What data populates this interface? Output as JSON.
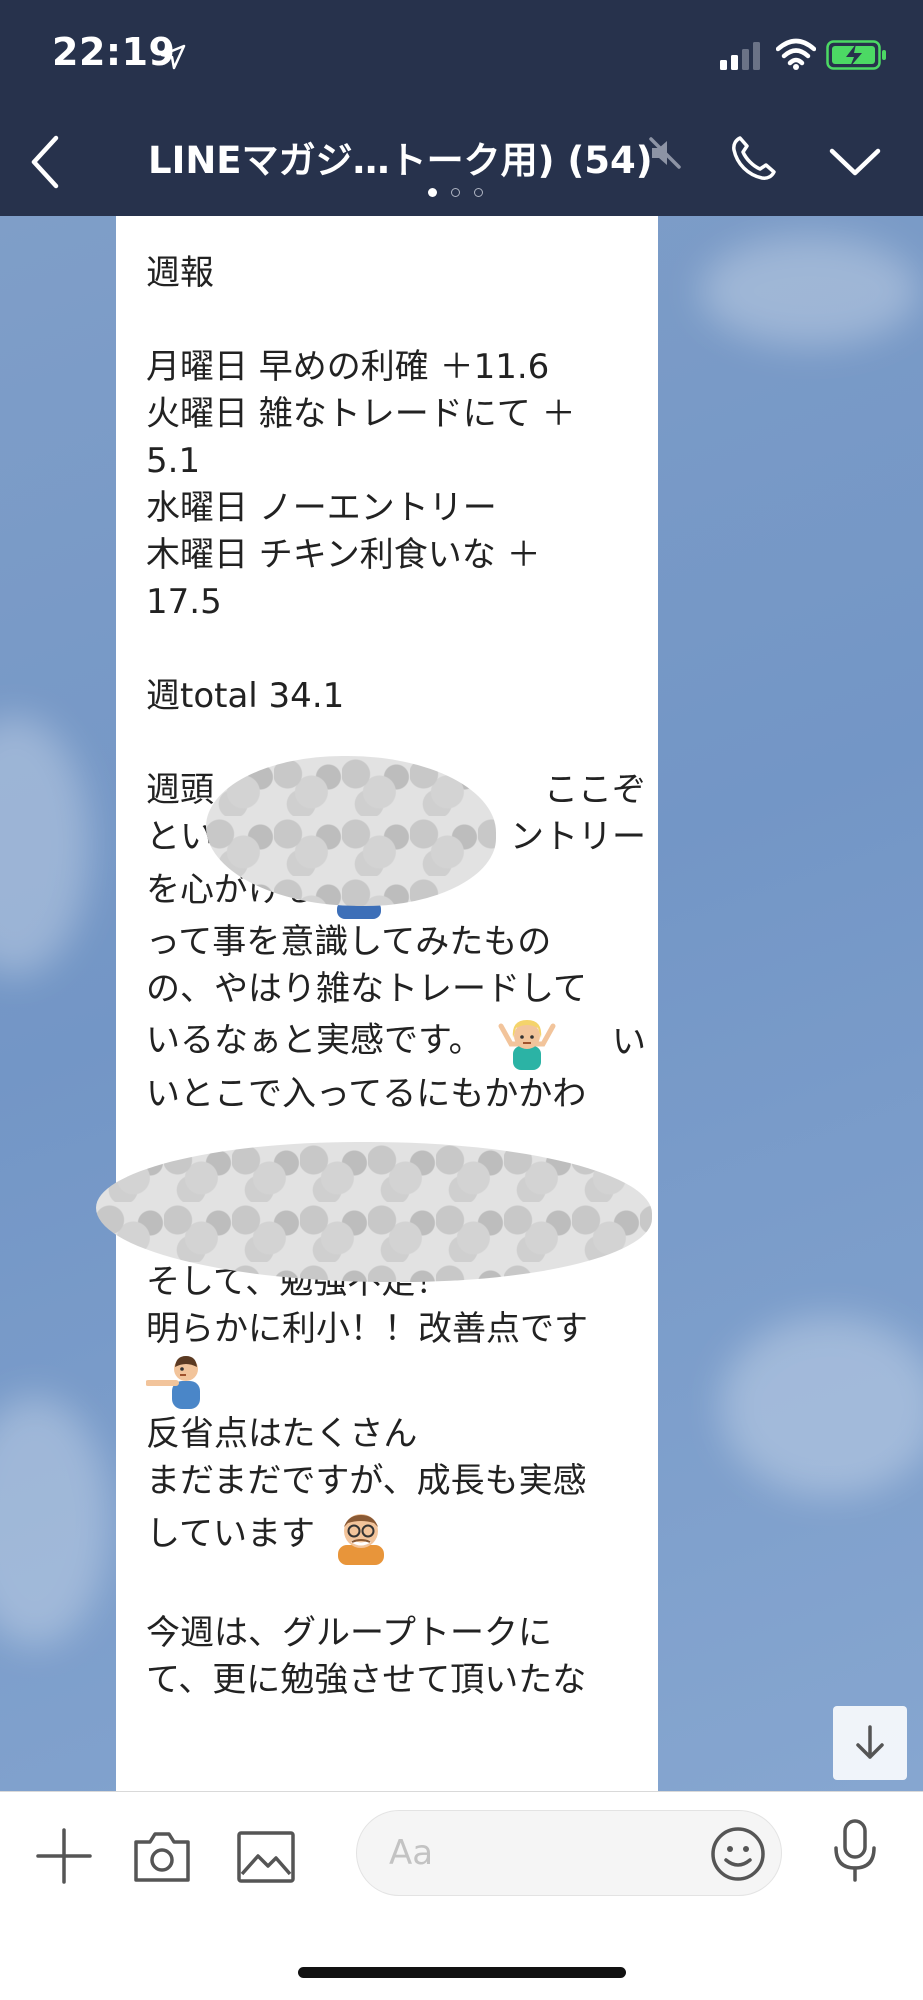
{
  "status_bar": {
    "time": "22:19",
    "icons": [
      "location-arrow-icon",
      "signal-bars-icon",
      "wifi-icon",
      "battery-charging-icon"
    ]
  },
  "header": {
    "title": "LINEマガジ…トーク用) (54)",
    "icons": [
      "back-chevron-icon",
      "mute-icon",
      "phone-icon",
      "chevron-down-icon"
    ],
    "page_dots": 3,
    "active_dot": 0
  },
  "message": {
    "lines": [
      "週報",
      "",
      "月曜日 早めの利確 ＋11.6",
      "火曜日 雑なトレードにて ＋",
      "5.1",
      "水曜日 ノーエントリー",
      "木曜日 チキン利食いな ＋",
      "17.5",
      "",
      "週total 34.1",
      "",
      "週頭",
      "とい",
      "を心がける",
      "って事を意識してみたもの",
      "の、やはり雑なトレードして",
      "いるなぁと実感です。",
      "いとこで入ってるにもかかわ",
      "",
      "",
      "",
      "そして、勉強不足！",
      "明らかに利小！！改善点です",
      "",
      "反省点はたくさん",
      "まだまだですが、成長も実感",
      "しています",
      "",
      "今週は、グループトークに",
      "て、更に勉強させて頂いたな"
    ],
    "partial_right_1": "ここぞ",
    "partial_right_2": "ントリー",
    "partial_right_3": "い",
    "emojis": [
      "frowning-man-emoji",
      "shrugging-woman-emoji",
      "pointing-man-emoji",
      "elderly-man-emoji"
    ]
  },
  "colors": {
    "header_bg": "#27324c",
    "chat_bg": "#7396c6",
    "bubble_bg": "#ffffff",
    "battery_green": "#4cd964"
  },
  "input_bar": {
    "placeholder": "Aa",
    "icons": [
      "plus-icon",
      "camera-icon",
      "image-icon",
      "smiley-icon",
      "microphone-icon"
    ]
  }
}
